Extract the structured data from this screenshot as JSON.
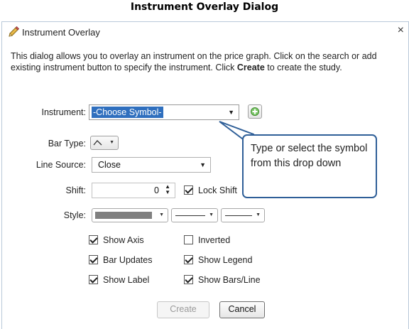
{
  "page": {
    "title": "Instrument Overlay Dialog"
  },
  "dialog": {
    "title": "Instrument Overlay",
    "close_glyph": "×",
    "description_1": "This dialog allows you to overlay an instrument on the price graph. Click on the search or add existing instrument button to specify the instrument. Click ",
    "description_bold": "Create",
    "description_2": " to create the study."
  },
  "form": {
    "instrument_label": "Instrument:",
    "instrument_value": "-Choose Symbol-",
    "bar_type_label": "Bar Type:",
    "line_source_label": "Line Source:",
    "line_source_value": "Close",
    "shift_label": "Shift:",
    "shift_value": "0",
    "lock_shift_label": "Lock Shift",
    "style_label": "Style:"
  },
  "checkboxes": {
    "show_axis": {
      "label": "Show Axis",
      "checked": true
    },
    "inverted": {
      "label": "Inverted",
      "checked": false
    },
    "bar_updates": {
      "label": "Bar Updates",
      "checked": true
    },
    "show_legend": {
      "label": "Show Legend",
      "checked": true
    },
    "show_label": {
      "label": "Show Label",
      "checked": true
    },
    "show_bars_line": {
      "label": "Show Bars/Line",
      "checked": true
    },
    "lock_shift": {
      "checked": true
    }
  },
  "callout": {
    "text": "Type or select the symbol from this drop down"
  },
  "buttons": {
    "create": "Create",
    "cancel": "Cancel"
  },
  "colors": {
    "accent": "#2f6fbe",
    "callout_border": "#2f5f98",
    "style_swatch": "#808080",
    "add_icon": "#5cb85c"
  },
  "icons": {
    "title": "pencil-icon",
    "add": "plus-icon",
    "bar_type": "line-chart-icon"
  }
}
